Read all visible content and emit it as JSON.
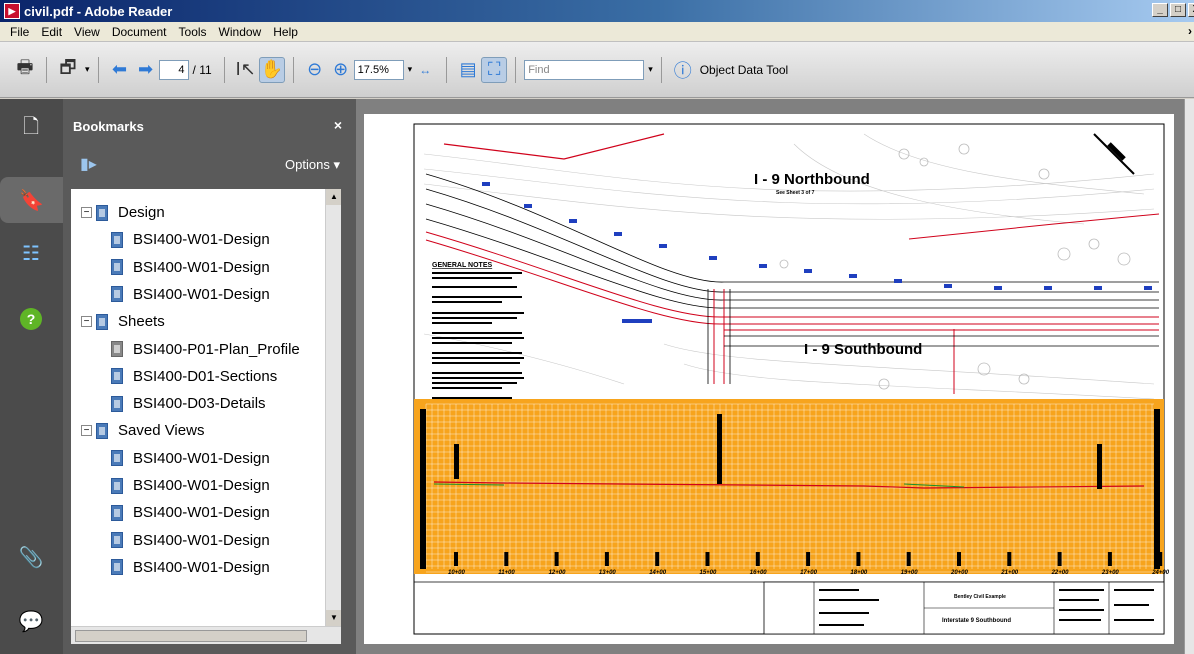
{
  "window": {
    "title": "civil.pdf - Adobe Reader",
    "controls": [
      "_",
      "□",
      "X"
    ]
  },
  "menu": [
    "File",
    "Edit",
    "View",
    "Document",
    "Tools",
    "Window",
    "Help"
  ],
  "toolbar": {
    "page_current": "4",
    "page_total": "/ 11",
    "zoom": "17.5%",
    "find_placeholder": "Find",
    "object_data_tool": "Object Data Tool"
  },
  "bookmarks": {
    "title": "Bookmarks",
    "options_label": "Options",
    "tree": [
      {
        "label": "Design",
        "level": 0,
        "toggle": "−"
      },
      {
        "label": "BSI400-W01-Design",
        "level": 1
      },
      {
        "label": "BSI400-W01-Design",
        "level": 1
      },
      {
        "label": "BSI400-W01-Design",
        "level": 1
      },
      {
        "label": "Sheets",
        "level": 0,
        "toggle": "−"
      },
      {
        "label": "BSI400-P01-Plan_Profile",
        "level": 1,
        "gray": true
      },
      {
        "label": "BSI400-D01-Sections",
        "level": 1
      },
      {
        "label": "BSI400-D03-Details",
        "level": 1
      },
      {
        "label": "Saved Views",
        "level": 0,
        "toggle": "−"
      },
      {
        "label": "BSI400-W01-Design",
        "level": 1
      },
      {
        "label": "BSI400-W01-Design",
        "level": 1
      },
      {
        "label": "BSI400-W01-Design",
        "level": 1
      },
      {
        "label": "BSI400-W01-Design",
        "level": 1
      },
      {
        "label": "BSI400-W01-Design",
        "level": 1
      }
    ]
  },
  "drawing": {
    "northbound": "I - 9 Northbound",
    "northbound_sub": "See Sheet 3 of 7",
    "southbound": "I - 9 Southbound",
    "general_notes": "GENERAL NOTES",
    "stations": [
      "10+00",
      "11+00",
      "12+00",
      "13+00",
      "14+00",
      "15+00",
      "16+00",
      "17+00",
      "18+00",
      "19+00",
      "20+00",
      "21+00",
      "22+00",
      "23+00",
      "24+00"
    ],
    "titleblock_company": "Bentley Civil Example",
    "titleblock_project": "Interstate 9 Southbound"
  },
  "colors": {
    "profile_grid": "#f7a41d",
    "accent_red": "#d0021b",
    "accent_blue": "#1f3fbf"
  }
}
